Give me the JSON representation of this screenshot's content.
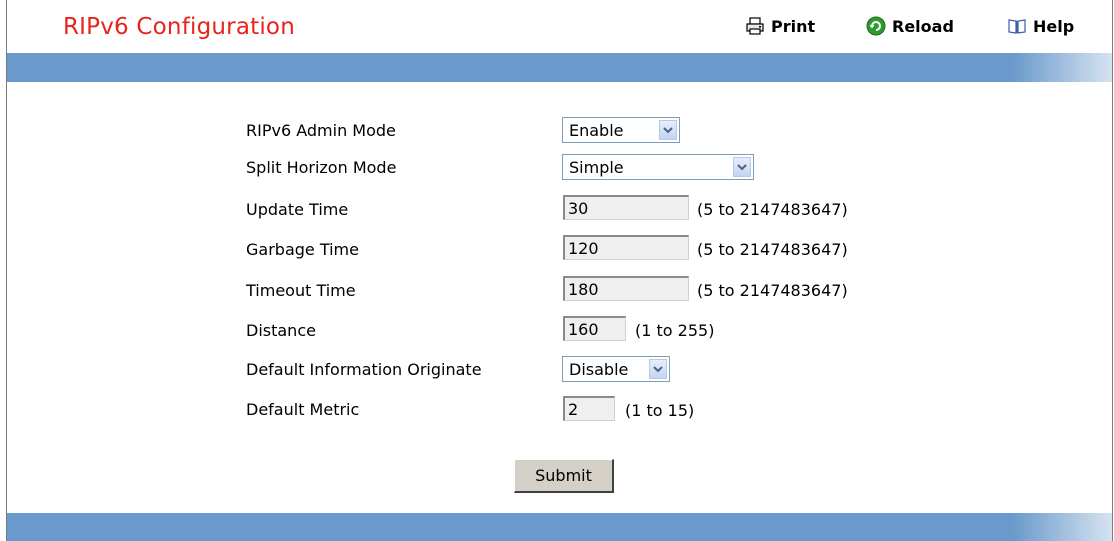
{
  "page": {
    "title": "RIPv6 Configuration"
  },
  "toolbar": {
    "print_label": "Print",
    "reload_label": "Reload",
    "help_label": "Help"
  },
  "form": {
    "admin_mode": {
      "label": "RIPv6 Admin Mode",
      "value": "Enable"
    },
    "split_horizon": {
      "label": "Split Horizon Mode",
      "value": "Simple"
    },
    "update_time": {
      "label": "Update Time",
      "value": "30",
      "range": "(5 to 2147483647)"
    },
    "garbage_time": {
      "label": "Garbage Time",
      "value": "120",
      "range": "(5 to 2147483647)"
    },
    "timeout_time": {
      "label": "Timeout Time",
      "value": "180",
      "range": "(5 to 2147483647)"
    },
    "distance": {
      "label": "Distance",
      "value": "160",
      "range": "(1 to 255)"
    },
    "default_info_originate": {
      "label": "Default Information Originate",
      "value": "Disable"
    },
    "default_metric": {
      "label": "Default Metric",
      "value": "2",
      "range": "(1 to 15)"
    }
  },
  "actions": {
    "submit_label": "Submit"
  },
  "colors": {
    "title": "#e8231c",
    "band": "#6a9acb",
    "button_face": "#d4d0c8"
  },
  "icons": [
    "printer-icon",
    "reload-icon",
    "help-book-icon",
    "chevron-down-icon"
  ]
}
